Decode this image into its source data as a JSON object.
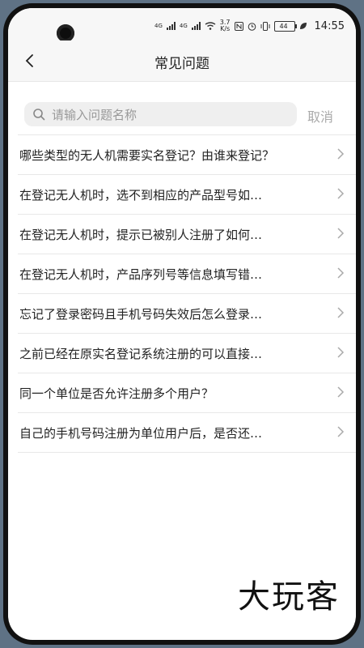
{
  "status": {
    "net1": "4G",
    "net2": "4G",
    "speed": "3.7",
    "speed_unit": "K/s",
    "battery": "44",
    "time": "14:55"
  },
  "nav": {
    "title": "常见问题"
  },
  "search": {
    "placeholder": "请输入问题名称",
    "value": "",
    "cancel_label": "取消"
  },
  "faq": {
    "items": [
      "哪些类型的无人机需要实名登记？由谁来登记？",
      "在登记无人机时，选不到相应的产品型号如…",
      "在登记无人机时，提示已被别人注册了如何…",
      "在登记无人机时，产品序列号等信息填写错…",
      "忘记了登录密码且手机号码失效后怎么登录…",
      "之前已经在原实名登记系统注册的可以直接…",
      "同一个单位是否允许注册多个用户？",
      "自己的手机号码注册为单位用户后，是否还…"
    ]
  },
  "watermark": "大玩客",
  "colors": {
    "navbar_bg": "#f7f7f7",
    "search_bg": "#efefef",
    "placeholder": "#999999",
    "cancel": "#aaaaaa",
    "divider": "#e8e8e8"
  }
}
